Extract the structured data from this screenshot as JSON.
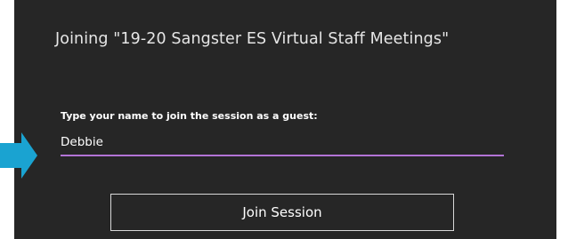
{
  "dialog": {
    "title": "Joining \"19-20 Sangster ES Virtual Staff Meetings\"",
    "name_label": "Type your name to join the session as a guest:",
    "name_value": "Debbie",
    "join_button_label": "Join Session"
  },
  "colors": {
    "panel_background": "#262626",
    "input_underline": "#b374d6",
    "arrow": "#1aa3d1",
    "button_border": "#d8d8d8"
  },
  "icons": {
    "pointer": "arrow-right-icon"
  }
}
